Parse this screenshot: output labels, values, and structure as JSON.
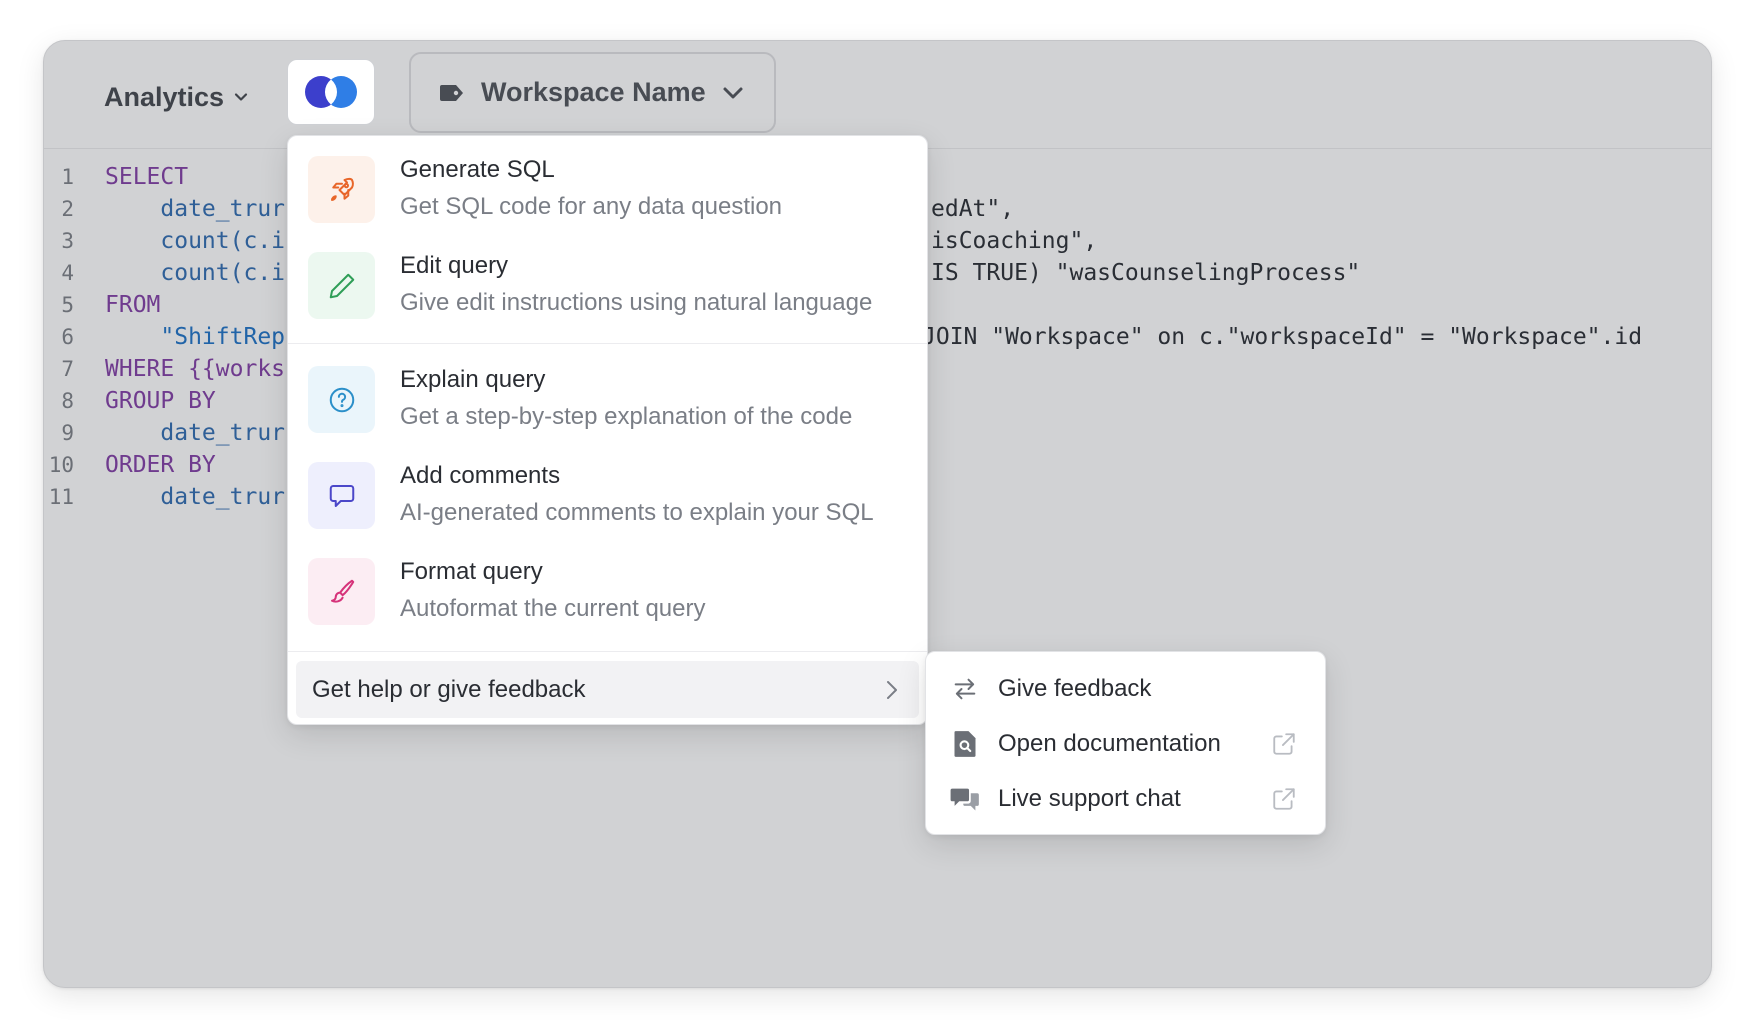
{
  "toolbar": {
    "database_label": "Analytics",
    "workspace_filter_label": "Workspace Name"
  },
  "editor": {
    "line_numbers": [
      "1",
      "2",
      "3",
      "4",
      "5",
      "6",
      "7",
      "8",
      "9",
      "10",
      "11"
    ],
    "lines": [
      {
        "left": "SELECT",
        "right": ""
      },
      {
        "left": "    date_trur",
        "right": "edAt\","
      },
      {
        "left": "    count(c.i",
        "right": "isCoaching\","
      },
      {
        "left": "    count(c.i",
        "right": "IS TRUE) \"wasCounselingProcess\""
      },
      {
        "left": "FROM",
        "right": ""
      },
      {
        "left": "    \"ShiftRep",
        "right": "JOIN \"Workspace\" on c.\"workspaceId\" = \"Workspace\".id"
      },
      {
        "left": "WHERE {{works",
        "right": ""
      },
      {
        "left": "GROUP BY",
        "right": ""
      },
      {
        "left": "    date_trur",
        "right": ""
      },
      {
        "left": "ORDER BY",
        "right": ""
      },
      {
        "left": "    date_trur",
        "right": ""
      }
    ]
  },
  "menu": {
    "items": [
      {
        "title": "Generate SQL",
        "description": "Get SQL code for any data question",
        "icon": "rocket-icon",
        "color": "#e8662a",
        "bg": "#fdf1ea"
      },
      {
        "title": "Edit query",
        "description": "Give edit instructions using natural language",
        "icon": "pencil-icon",
        "color": "#2f9e57",
        "bg": "#ecf8f0"
      },
      {
        "title": "Explain query",
        "description": "Get a step-by-step explanation of the code",
        "icon": "question-circle-icon",
        "color": "#2b8fc9",
        "bg": "#eaf5fb"
      },
      {
        "title": "Add comments",
        "description": "AI-generated comments to explain your SQL",
        "icon": "speech-bubble-icon",
        "color": "#4b47c9",
        "bg": "#eeeffd"
      },
      {
        "title": "Format query",
        "description": "Autoformat the current query",
        "icon": "paintbrush-icon",
        "color": "#d6337a",
        "bg": "#fcedf3"
      }
    ],
    "help_label": "Get help or give feedback"
  },
  "submenu": {
    "items": [
      {
        "label": "Give feedback",
        "icon": "arrows-exchange-icon",
        "external": false
      },
      {
        "label": "Open documentation",
        "icon": "document-search-icon",
        "external": true
      },
      {
        "label": "Live support chat",
        "icon": "chat-bubbles-icon",
        "external": true
      }
    ]
  }
}
